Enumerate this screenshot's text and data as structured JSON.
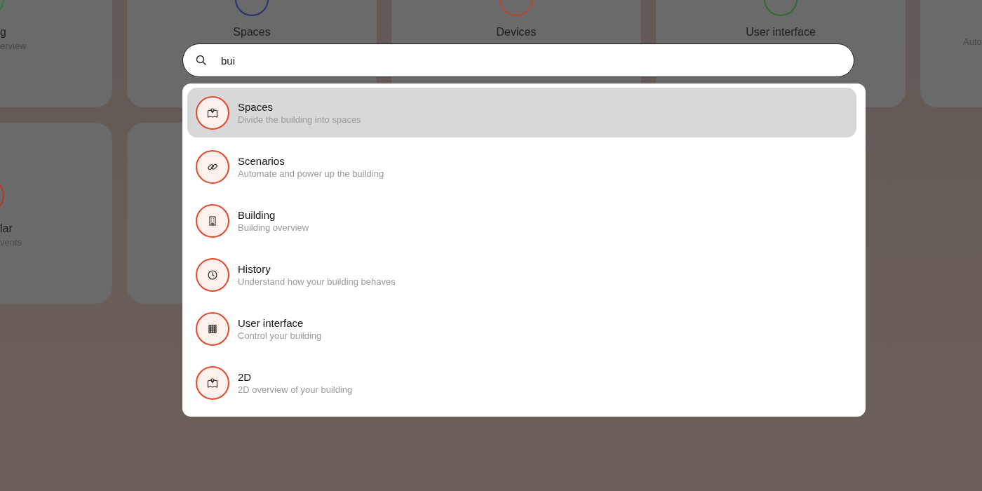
{
  "background_cards": [
    {
      "title": "g",
      "subtitle": "erview",
      "color": "#2f7a4a"
    },
    {
      "title": "Spaces",
      "color": "#2b3170"
    },
    {
      "title": "Devices",
      "color": "#b24a2e"
    },
    {
      "title": "User interface",
      "color": "#2f6b3a"
    },
    {
      "subtitle": "Auto"
    },
    {
      "title": "lar",
      "subtitle": "vents",
      "color": "#b8352a"
    }
  ],
  "search": {
    "value": "bui"
  },
  "results": [
    {
      "title": "Spaces",
      "subtitle": "Divide the building into spaces",
      "selected": true
    },
    {
      "title": "Scenarios",
      "subtitle": "Automate and power up the building",
      "selected": false
    },
    {
      "title": "Building",
      "subtitle": "Building overview",
      "selected": false
    },
    {
      "title": "History",
      "subtitle": "Understand how your building behaves",
      "selected": false
    },
    {
      "title": "User interface",
      "subtitle": "Control your building",
      "selected": false
    },
    {
      "title": "2D",
      "subtitle": "2D overview of your building",
      "selected": false
    }
  ]
}
